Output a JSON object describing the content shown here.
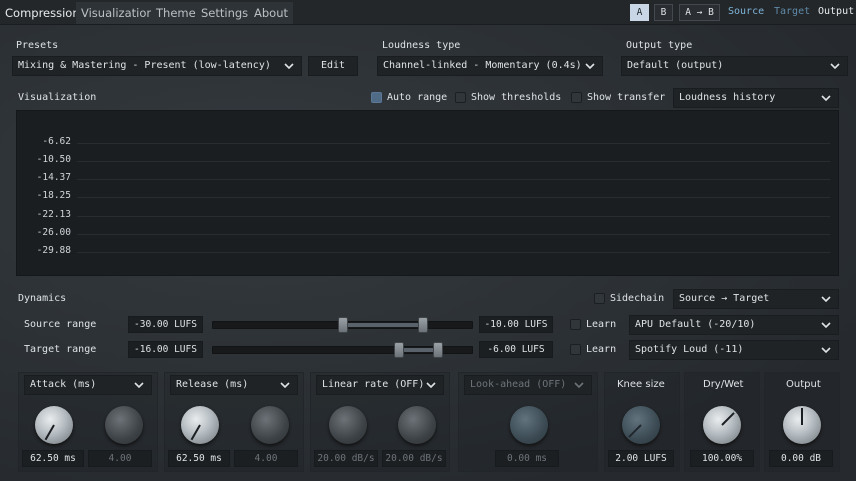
{
  "tabs": [
    "Compression",
    "Visualization",
    "Theme",
    "Settings",
    "About"
  ],
  "ab": {
    "a": "A",
    "b": "B",
    "a_to_b": "A → B"
  },
  "top_links": {
    "source": "Source",
    "target": "Target",
    "output": "Output"
  },
  "colors": {
    "accent": "#c8d6e6",
    "link": "#7fb4d8"
  },
  "presets": {
    "label": "Presets",
    "value": "Mixing & Mastering - Present (low-latency)",
    "edit": "Edit"
  },
  "loudness_type": {
    "label": "Loudness type",
    "value": "Channel-linked - Momentary (0.4s)"
  },
  "output_type": {
    "label": "Output type",
    "value": "Default (output)"
  },
  "visualization": {
    "label": "Visualization",
    "auto_range": "Auto range",
    "auto_range_checked": true,
    "show_thresholds": "Show thresholds",
    "show_transfer": "Show transfer",
    "mode": "Loudness history",
    "y_ticks": [
      "-6.62",
      "-10.50",
      "-14.37",
      "-18.25",
      "-22.13",
      "-26.00",
      "-29.88"
    ]
  },
  "dynamics": {
    "label": "Dynamics",
    "sidechain": "Sidechain",
    "routing": "Source → Target",
    "source_range": {
      "label": "Source range",
      "min": "-30.00 LUFS",
      "max": "-10.00 LUFS",
      "learn": "Learn",
      "preset": "APU Default (-20/10)",
      "low_frac": 0.5,
      "high_frac": 0.81
    },
    "target_range": {
      "label": "Target range",
      "min": "-16.00 LUFS",
      "max": "-6.00 LUFS",
      "learn": "Learn",
      "preset": "Spotify Loud (-11)",
      "low_frac": 0.72,
      "high_frac": 0.87
    }
  },
  "controls": {
    "attack": {
      "label": "Attack (ms)",
      "value": "62.50 ms",
      "value2": "4.00"
    },
    "release": {
      "label": "Release (ms)",
      "value": "62.50 ms",
      "value2": "4.00"
    },
    "linear_rate": {
      "label": "Linear rate (OFF)",
      "value": "20.00 dB/s",
      "value2": "20.00 dB/s"
    },
    "look_ahead": {
      "label": "Look-ahead (OFF)",
      "value": "0.00 ms"
    },
    "knee": {
      "label": "Knee size",
      "value": "2.00 LUFS"
    },
    "drywet": {
      "label": "Dry/Wet",
      "value": "100.00%"
    },
    "output": {
      "label": "Output",
      "value": "0.00 dB"
    }
  }
}
